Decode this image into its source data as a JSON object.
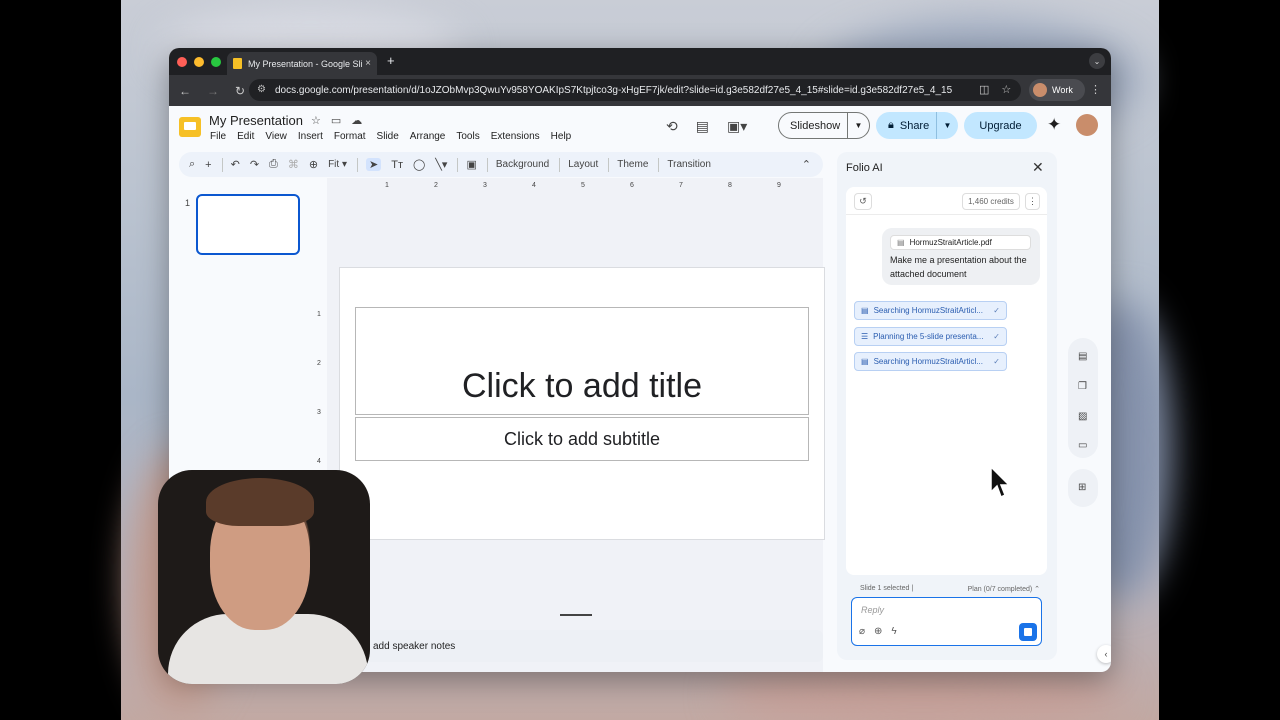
{
  "browser": {
    "tab_title": "My Presentation - Google Sli",
    "tab_close": "×",
    "new_tab": "+",
    "tab_menu": "⌄",
    "url": "docs.google.com/presentation/d/1oJZObMvp3QwuYv958YOAKIpS7Ktpjtco3g-xHgEF7jk/edit?slide=id.g3e582df27e5_4_15#slide=id.g3e582df27e5_4_15",
    "profile_label": "Work"
  },
  "app": {
    "doc_title": "My Presentation",
    "menu": [
      "File",
      "Edit",
      "View",
      "Insert",
      "Format",
      "Slide",
      "Arrange",
      "Tools",
      "Extensions",
      "Help"
    ],
    "slideshow_label": "Slideshow",
    "share_label": "Share",
    "upgrade_label": "Upgrade"
  },
  "toolbar": {
    "zoom": "Fit",
    "background": "Background",
    "layout": "Layout",
    "theme": "Theme",
    "transition": "Transition"
  },
  "filmstrip": {
    "slide_number": "1"
  },
  "ruler": {
    "h_ticks": [
      "1",
      "2",
      "3",
      "4",
      "5",
      "6",
      "7",
      "8",
      "9"
    ],
    "v_ticks": [
      "1",
      "2",
      "3",
      "4"
    ]
  },
  "slide": {
    "title_placeholder": "Click to add title",
    "subtitle_placeholder": "Click to add subtitle"
  },
  "notes": {
    "placeholder": "add speaker notes"
  },
  "panel": {
    "title": "Folio AI",
    "credits": "1,460 credits",
    "attachment": "HormuzStraitArticle.pdf",
    "user_message": "Make me a presentation about the attached document",
    "steps": [
      {
        "label": "Searching HormuzStraitArticl..."
      },
      {
        "label": "Planning the 5-slide presenta..."
      },
      {
        "label": "Searching HormuzStraitArticl..."
      }
    ],
    "selection_status": "Slide 1 selected",
    "plan_status": "Plan (0/7 completed)",
    "reply_placeholder": "Reply"
  },
  "colors": {
    "accent": "#0b57d0",
    "share_bg": "#c2e7ff",
    "step_bg": "#e7f0fd",
    "send_button": "#1a73e8"
  }
}
